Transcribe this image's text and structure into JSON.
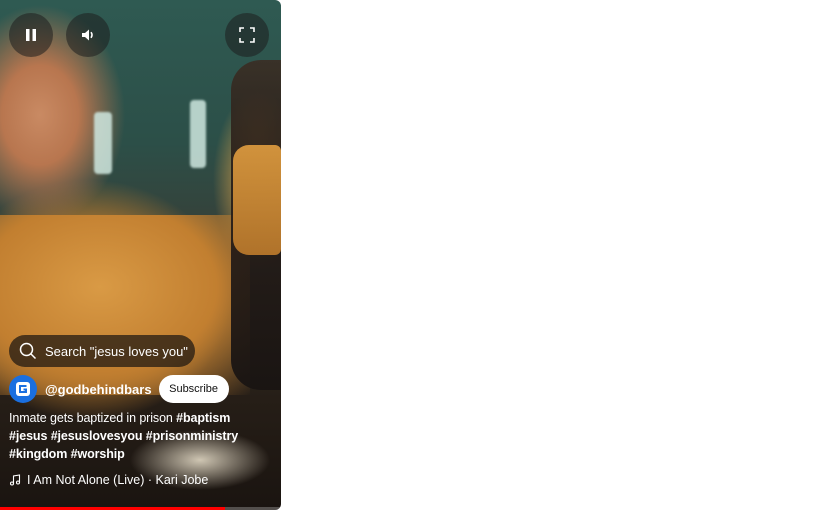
{
  "player": {
    "pause_icon": "pause-icon",
    "volume_icon": "volume-icon",
    "fullscreen_icon": "fullscreen-icon",
    "progress_fraction": 0.8
  },
  "search_chip": {
    "label": "Search \"jesus loves you\"",
    "icon": "search-icon"
  },
  "channel": {
    "handle": "@godbehindbars",
    "subscribe_label": "Subscribe",
    "avatar_color": "#1a6fe0"
  },
  "description": {
    "text": "Inmate gets baptized in prison",
    "hashtags": [
      "#baptism",
      "#jesus",
      "#jesuslovesyou",
      "#prisonministry",
      "#kingdom",
      "#worship"
    ]
  },
  "music": {
    "icon": "music-note-icon",
    "track": "I Am Not Alone (Live) · Kari Jobe"
  },
  "colors": {
    "progress": "#ff0000",
    "subscribe_bg": "#ffffff"
  }
}
